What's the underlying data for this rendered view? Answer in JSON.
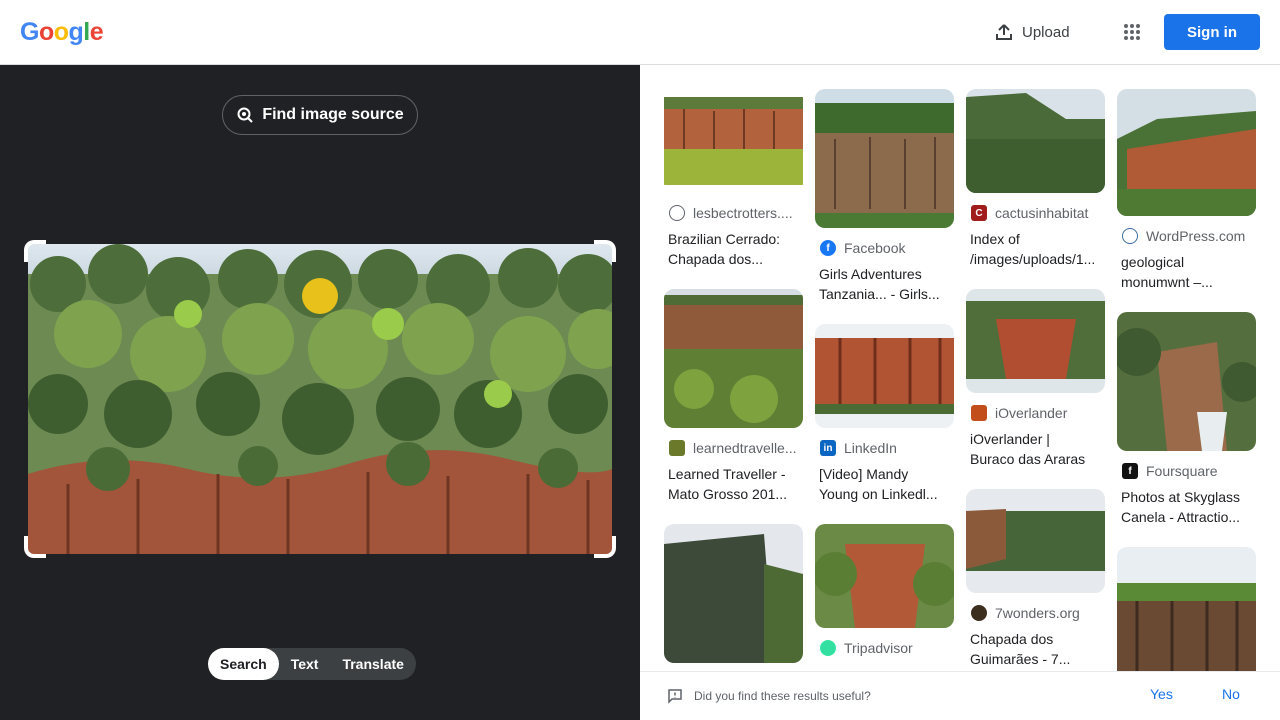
{
  "header": {
    "logo_letters": [
      "G",
      "o",
      "o",
      "g",
      "l",
      "e"
    ],
    "logo_colors": [
      "#4285f4",
      "#ea4335",
      "#fbbc05",
      "#4285f4",
      "#34a853",
      "#ea4335"
    ],
    "upload_label": "Upload",
    "signin_label": "Sign in",
    "accent": "#1a73e8"
  },
  "left": {
    "find_source_label": "Find image source",
    "modes": [
      "Search",
      "Text",
      "Translate"
    ],
    "active_mode": "Search"
  },
  "results": {
    "col1": [
      {
        "source": "lesbectrotters....",
        "title1": "Brazilian Cerrado:",
        "title2": "Chapada dos..."
      },
      {
        "source": "learnedtravelle...",
        "title1": "Learned Traveller -",
        "title2": "Mato Grosso 201..."
      },
      {
        "source": "",
        "title1": "",
        "title2": ""
      }
    ],
    "col2": [
      {
        "source": "Facebook",
        "title1": "Girls Adventures",
        "title2": "Tanzania... - Girls..."
      },
      {
        "source": "LinkedIn",
        "title1": "[Video] Mandy",
        "title2": "Young on Linkedl..."
      },
      {
        "source": "Tripadvisor",
        "title1": "",
        "title2": ""
      }
    ],
    "col3": [
      {
        "source": "cactusinhabitat",
        "title1": "Index of",
        "title2": "/images/uploads/1..."
      },
      {
        "source": "iOverlander",
        "title1": "iOverlander |",
        "title2": "Buraco das Araras"
      },
      {
        "source": "7wonders.org",
        "title1": "Chapada dos",
        "title2": "Guimarães - 7..."
      }
    ],
    "col4": [
      {
        "source": "WordPress.com",
        "title1": "geological",
        "title2": "monumwnt –..."
      },
      {
        "source": "Foursquare",
        "title1": "Photos at Skyglass",
        "title2": "Canela - Attractio..."
      },
      {
        "source": "",
        "title1": "",
        "title2": ""
      }
    ]
  },
  "feedback": {
    "question": "Did you find these results useful?",
    "yes": "Yes",
    "no": "No"
  }
}
